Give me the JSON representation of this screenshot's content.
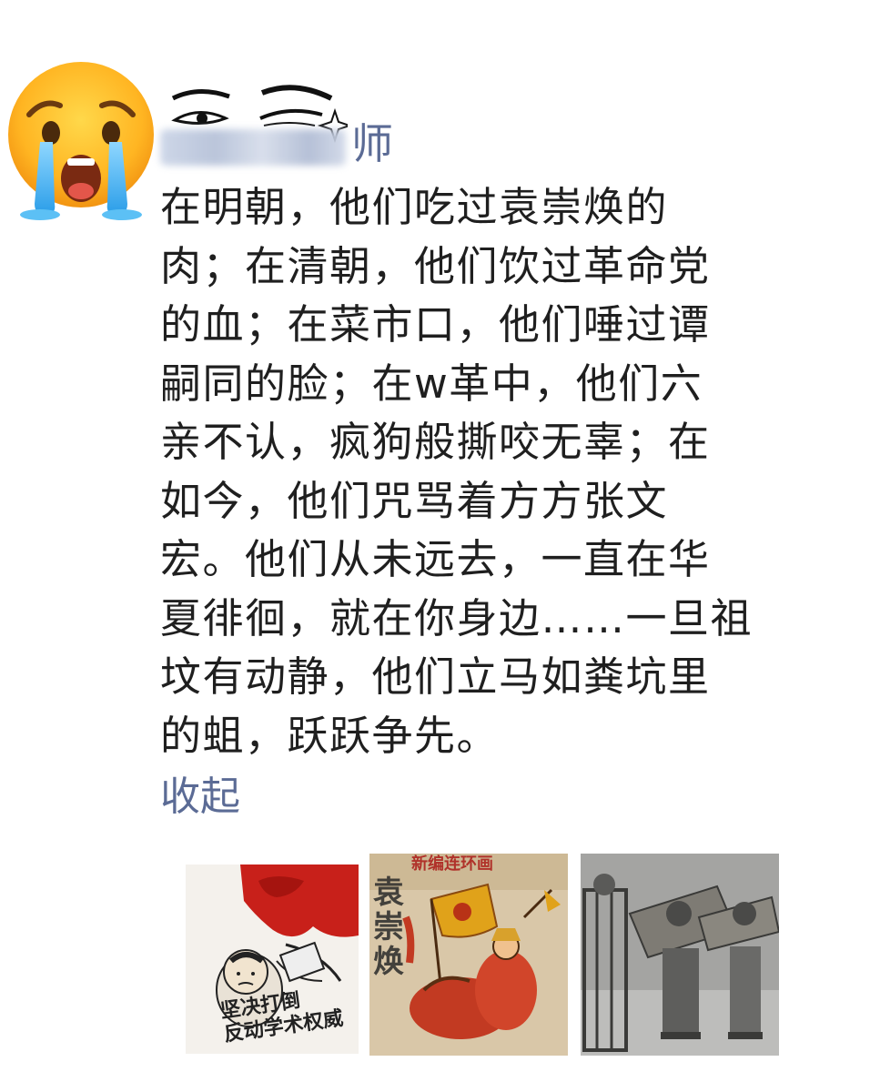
{
  "post": {
    "author_suffix": "师",
    "body": "在明朝，他们吃过袁崇焕的\n肉；在清朝，他们饮过革命党\n的血；在菜市口，他们唾过谭\n嗣同的脸；在w革中，他们六\n亲不认，疯狗般撕咬无辜；在\n如今，他们咒骂着方方张文\n宏。他们从未远去，一直在华\n夏徘徊，就在你身边……一旦祖\n坟有动静，他们立马如粪坑里\n的蛆，跃跃争先。",
    "collapse_label": "收起"
  },
  "avatar": {
    "emoji_icon": "crying-face-icon",
    "sketch_icon": "sketched-eyes-icon"
  },
  "images": [
    {
      "id_label": "poster-propaganda",
      "caption": "坚决打倒\n反动学术权威"
    },
    {
      "id_label": "comic-cover",
      "vertical_title": "袁崇焕",
      "header": "新编连环画"
    },
    {
      "id_label": "historical-photo"
    }
  ],
  "colors": {
    "link": "#5b6b95",
    "text": "#1f1f1f",
    "background": "#ffffff"
  }
}
